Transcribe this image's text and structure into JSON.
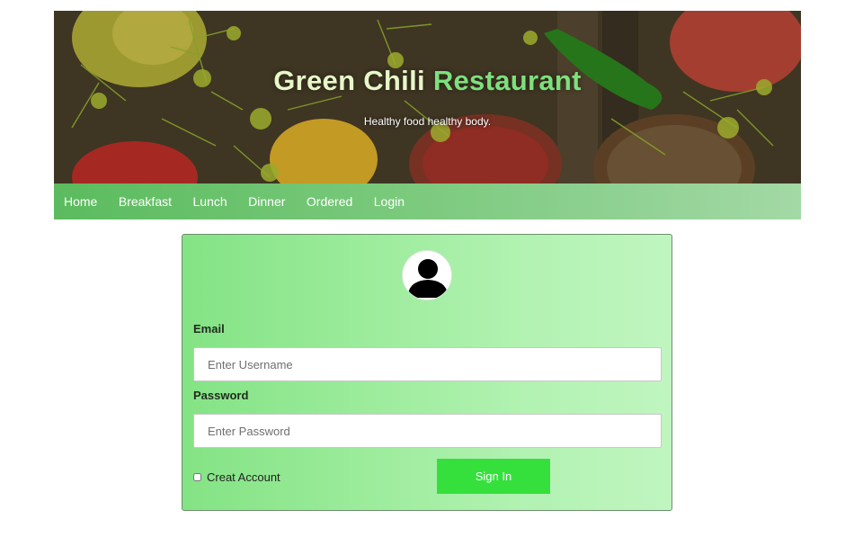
{
  "header": {
    "title_part1": "Green Chili",
    "title_part2": "Restaurant",
    "subtitle": "Healthy food healthy body."
  },
  "nav": {
    "items": [
      "Home",
      "Breakfast",
      "Lunch",
      "Dinner",
      "Ordered",
      "Login"
    ]
  },
  "login": {
    "avatar_icon": "user-avatar-icon",
    "email_label": "Email",
    "email_placeholder": "Enter Username",
    "password_label": "Password",
    "password_placeholder": "Enter Password",
    "create_account_label": "Creat Account",
    "sign_in_label": "Sign In"
  },
  "colors": {
    "title_light": "#e6f7c8",
    "title_green": "#7de07d",
    "nav_bg": "#5bbb5e",
    "card_bg": "#84e384",
    "sign_in_bg": "#35e03c"
  }
}
